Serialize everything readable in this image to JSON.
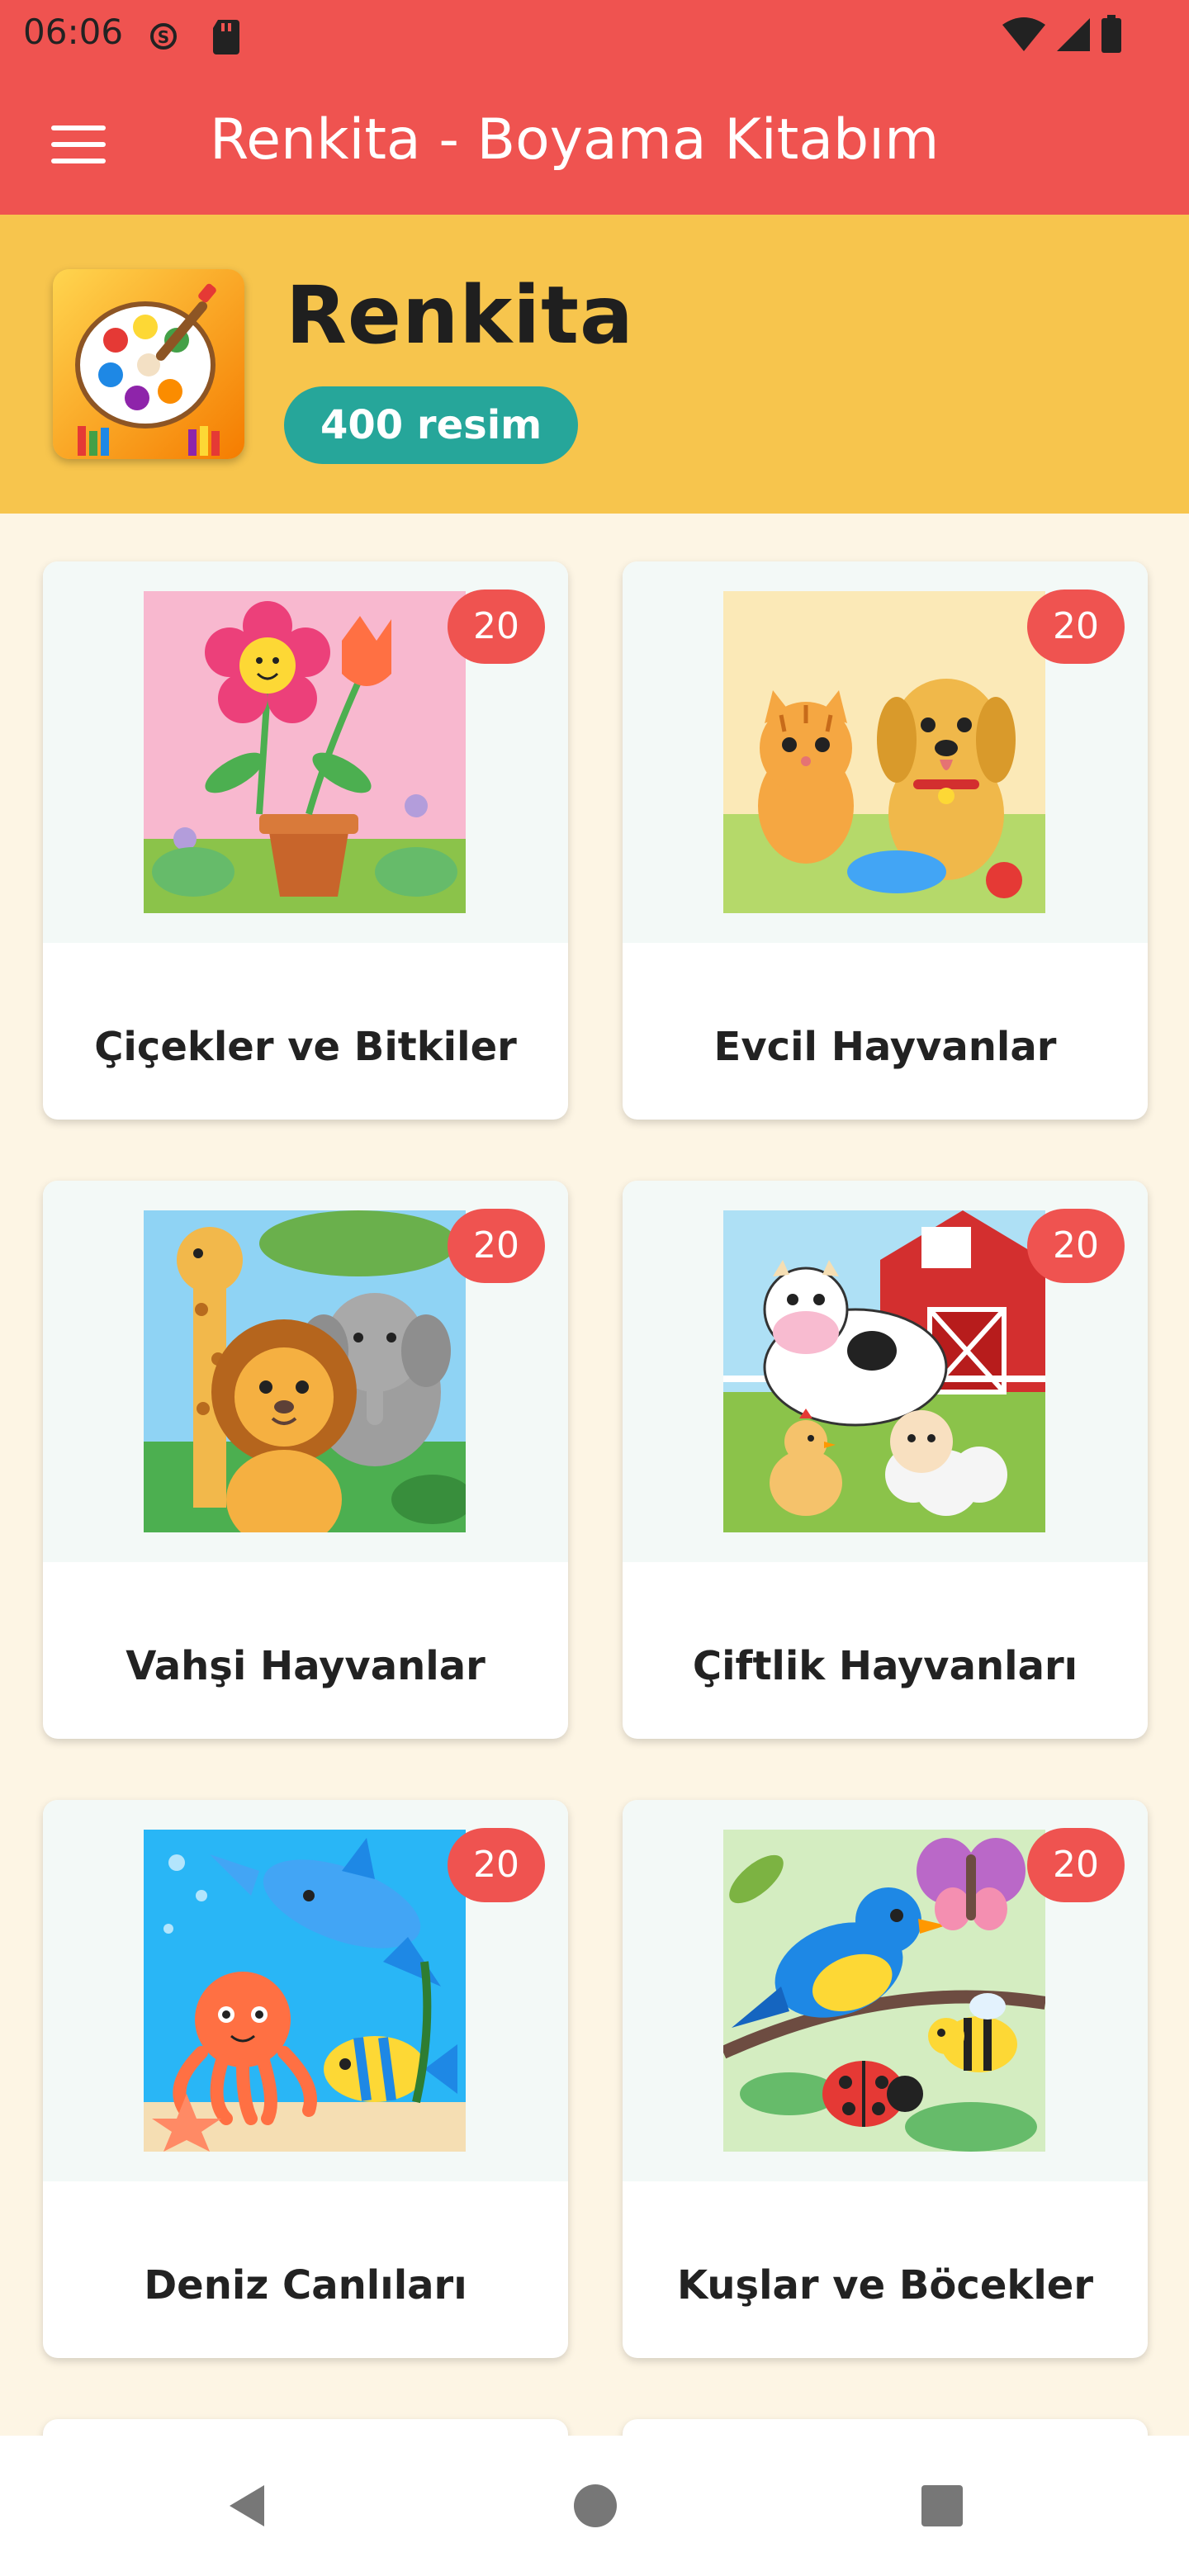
{
  "status_bar": {
    "time": "06:06",
    "icons": [
      "data-saver-icon",
      "sd-card-icon",
      "wifi-icon",
      "signal-icon",
      "battery-icon"
    ]
  },
  "app_bar": {
    "title": "Renkita - Boyama Kitabım",
    "menu_icon": "hamburger-menu-icon"
  },
  "header": {
    "title": "Renkita",
    "count": "400 resim",
    "logo_icon": "palette-logo-icon"
  },
  "colors": {
    "primary": "#ef5350",
    "header_bg": "#f7c54d",
    "accent": "#26a69a",
    "page_bg": "#fdf5e4"
  },
  "categories": [
    {
      "label": "Çiçekler ve Bitkiler",
      "count": "20",
      "image": "flowers-illustration"
    },
    {
      "label": "Evcil Hayvanlar",
      "count": "20",
      "image": "pets-illustration"
    },
    {
      "label": "Vahşi Hayvanlar",
      "count": "20",
      "image": "wild-animals-illustration"
    },
    {
      "label": "Çiftlik Hayvanları",
      "count": "20",
      "image": "farm-animals-illustration"
    },
    {
      "label": "Deniz Canlıları",
      "count": "20",
      "image": "sea-creatures-illustration"
    },
    {
      "label": "Kuşlar ve Böcekler",
      "count": "20",
      "image": "birds-insects-illustration"
    }
  ],
  "nav_bar": {
    "icons": [
      "back-icon",
      "home-icon",
      "recents-icon"
    ]
  }
}
